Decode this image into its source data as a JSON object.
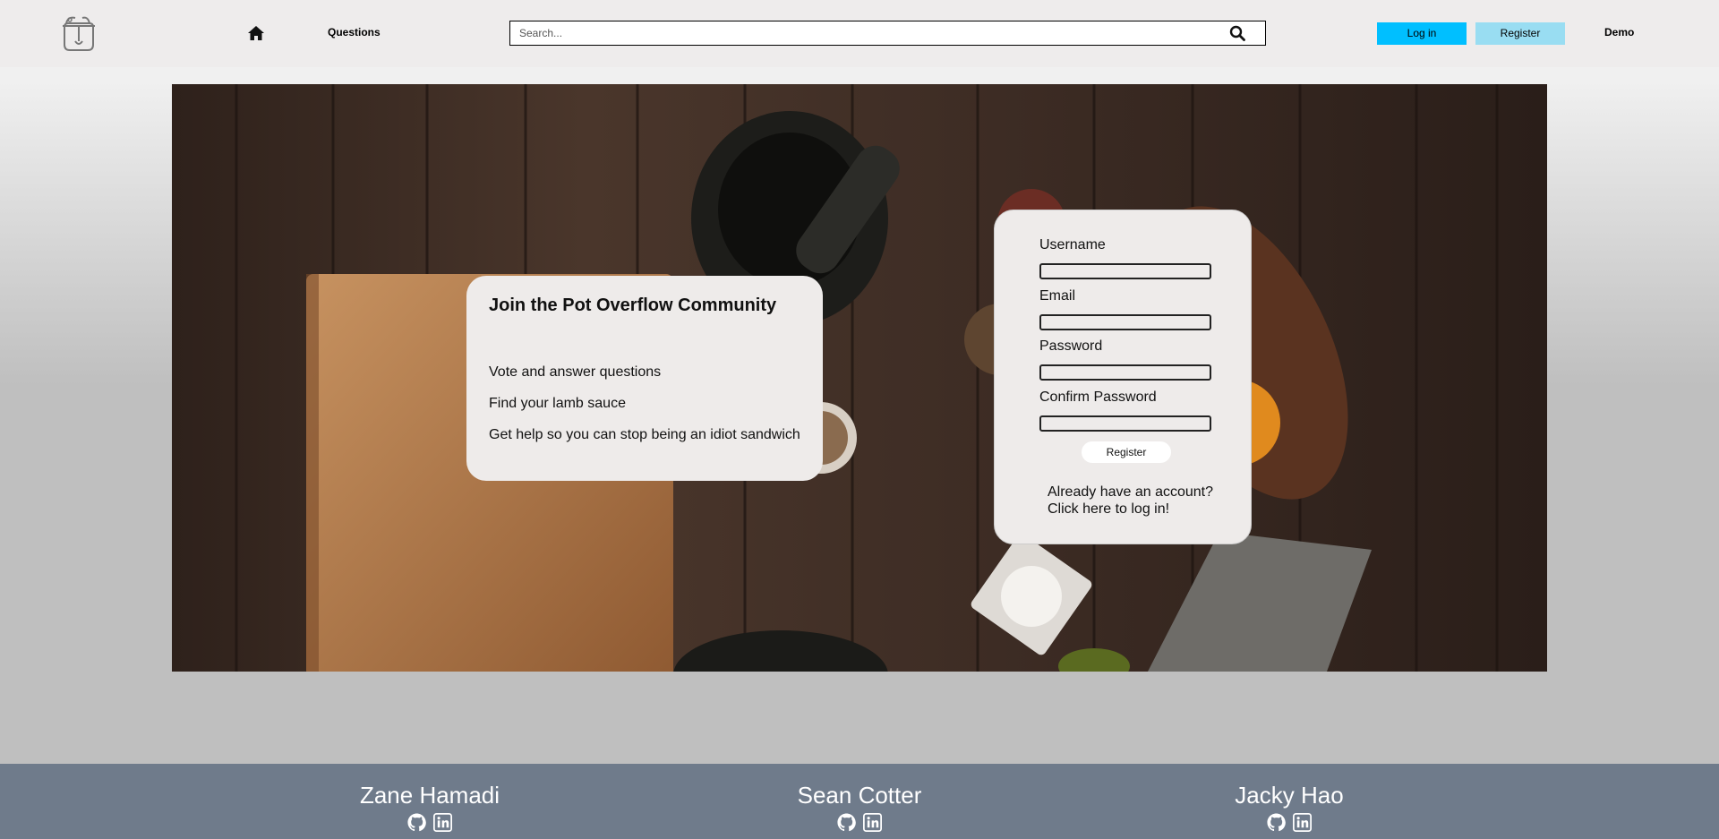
{
  "nav": {
    "logo_icon": "cooking-pot-logo-icon",
    "home_icon": "home-icon",
    "questions_label": "Questions",
    "search_placeholder": "Search...",
    "search_icon": "search-icon",
    "login_label": "Log in",
    "register_label": "Register",
    "demo_label": "Demo",
    "colors": {
      "login_bg": "#00bfff",
      "register_bg": "#99ddf2"
    }
  },
  "hero": {
    "info_card": {
      "title": "Join the Pot Overflow Community",
      "bullets": [
        "Vote and answer questions",
        "Find your lamb sauce",
        "Get help so you can stop being an idiot sandwich"
      ]
    },
    "signup_form": {
      "fields": [
        {
          "label": "Username",
          "value": ""
        },
        {
          "label": "Email",
          "value": ""
        },
        {
          "label": "Password",
          "value": ""
        },
        {
          "label": "Confirm Password",
          "value": ""
        }
      ],
      "submit_label": "Register",
      "login_prompt_line1": "Already have an account?",
      "login_prompt_line2": "Click here to log in!"
    }
  },
  "footer": {
    "members": [
      {
        "name": "Zane Hamadi",
        "icons": [
          "github-icon",
          "linkedin-icon"
        ]
      },
      {
        "name": "Sean Cotter",
        "icons": [
          "github-icon",
          "linkedin-icon"
        ]
      },
      {
        "name": "Jacky Hao",
        "icons": [
          "github-icon",
          "linkedin-icon"
        ]
      }
    ],
    "background": "#6f7b8b"
  }
}
